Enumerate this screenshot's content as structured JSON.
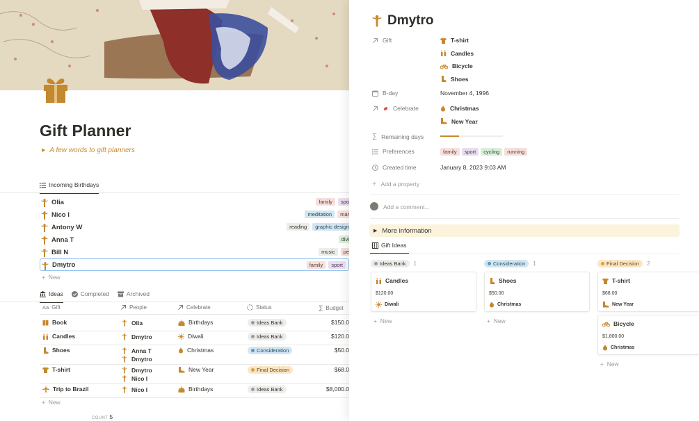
{
  "page": {
    "title": "Gift Planner",
    "quote": "A few words to gift planners",
    "birthdays_tab": "Incoming Birthdays"
  },
  "birthdays": {
    "rows": [
      {
        "name": "Olia",
        "tags": [
          "family",
          "spo"
        ]
      },
      {
        "name": "Nico I",
        "tags": [
          "meditation",
          "mar"
        ]
      },
      {
        "name": "Antony W",
        "tags": [
          "reading",
          "graphic design"
        ]
      },
      {
        "name": "Anna T",
        "tags": [
          "divi"
        ]
      },
      {
        "name": "Bill N",
        "tags": [
          "music",
          "pe"
        ]
      },
      {
        "name": "Dmytro",
        "tags": [
          "family",
          "sport"
        ]
      }
    ],
    "new_label": "New"
  },
  "ideas": {
    "tabs": [
      "Ideas",
      "Completed",
      "Archived"
    ],
    "columns": [
      "Gift",
      "People",
      "Celebrate",
      "Status",
      "Budget"
    ],
    "column_prefix": "Aa",
    "rows": [
      {
        "gift": "Book",
        "people": [
          "Olia"
        ],
        "celebrate": "Birthdays",
        "status": "Ideas Bank",
        "budget": "$150.0"
      },
      {
        "gift": "Candles",
        "people": [
          "Dmytro"
        ],
        "celebrate": "Diwali",
        "status": "Ideas Bank",
        "budget": "$120.0"
      },
      {
        "gift": "Shoes",
        "people": [
          "Anna T",
          "Dmytro"
        ],
        "celebrate": "Christmas",
        "status": "Consideration",
        "budget": "$50.0"
      },
      {
        "gift": "T-shirt",
        "people": [
          "Dmytro",
          "Nico I"
        ],
        "celebrate": "New Year",
        "status": "Final Decision",
        "budget": "$68.0"
      },
      {
        "gift": "Trip to Brazil",
        "people": [
          "Nico I"
        ],
        "celebrate": "Birthdays",
        "status": "Ideas Bank",
        "budget": "$8,000.0"
      }
    ],
    "new_label": "New",
    "count_label": "COUNT",
    "count_value": "5"
  },
  "panel": {
    "title": "Dmytro",
    "props": {
      "gift_label": "Gift",
      "gifts": [
        "T-shirt",
        "Candles",
        "Bicycle",
        "Shoes"
      ],
      "bday_label": "B-day",
      "bday_value": "November 4, 1996",
      "celebrate_label": "Celebrate",
      "celebrates": [
        "Christmas",
        "New Year"
      ],
      "remaining_label": "Remaining days",
      "remaining_fraction": 0.3,
      "preferences_label": "Preferences",
      "preferences": [
        "family",
        "sport",
        "cycling",
        "running"
      ],
      "created_label": "Created time",
      "created_value": "January 8, 2023 9:03 AM",
      "add_property": "Add a property"
    },
    "comment_placeholder": "Add a comment...",
    "more_info": "More information",
    "board_tab": "Gift Ideas",
    "groups": [
      {
        "name": "Ideas Bank",
        "count": "1",
        "cards": [
          {
            "title": "Candles",
            "price": "$120.00",
            "celebrate": "Diwali"
          }
        ]
      },
      {
        "name": "Consideration",
        "count": "1",
        "cards": [
          {
            "title": "Shoes",
            "price": "$50.00",
            "celebrate": "Christmas"
          }
        ]
      },
      {
        "name": "Final Decision",
        "count": "2",
        "cards": [
          {
            "title": "T-shirt",
            "price": "$68.00",
            "celebrate": "New Year"
          },
          {
            "title": "Bicycle",
            "price": "$1,800.00",
            "celebrate": "Christmas"
          }
        ]
      }
    ],
    "new_label": "New"
  },
  "colors": {
    "accent": "#c9892a",
    "icon_gold": "#c4882f",
    "selected_border": "#93c2f0"
  },
  "icons": {
    "person": "person-icon",
    "gift": "gift-icon"
  }
}
